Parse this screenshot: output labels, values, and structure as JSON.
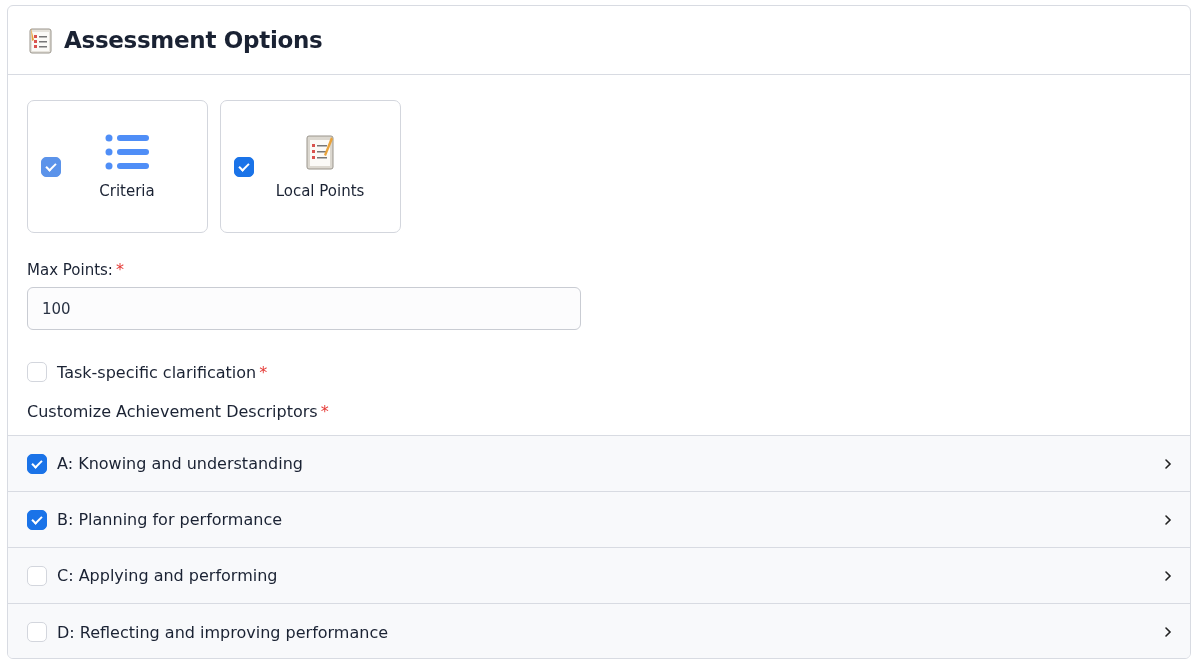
{
  "panel": {
    "title": "Assessment Options"
  },
  "options": [
    {
      "kind": "criteria",
      "label": "Criteria",
      "checked": true,
      "disabled": true
    },
    {
      "kind": "local_points",
      "label": "Local Points",
      "checked": true,
      "disabled": false
    }
  ],
  "max_points": {
    "label": "Max Points:",
    "required_mark": "*",
    "value": "100"
  },
  "clarification": {
    "label": "Task-specific clarification",
    "required_mark": "*",
    "checked": false
  },
  "descriptors": {
    "label": "Customize Achievement Descriptors",
    "required_mark": "*",
    "items": [
      {
        "label": "A: Knowing and understanding",
        "checked": true,
        "expanded": false
      },
      {
        "label": "B: Planning for performance",
        "checked": true,
        "expanded": false
      },
      {
        "label": "C: Applying and performing",
        "checked": false,
        "expanded": false
      },
      {
        "label": "D: Reflecting and improving performance",
        "checked": false,
        "expanded": false
      }
    ]
  }
}
